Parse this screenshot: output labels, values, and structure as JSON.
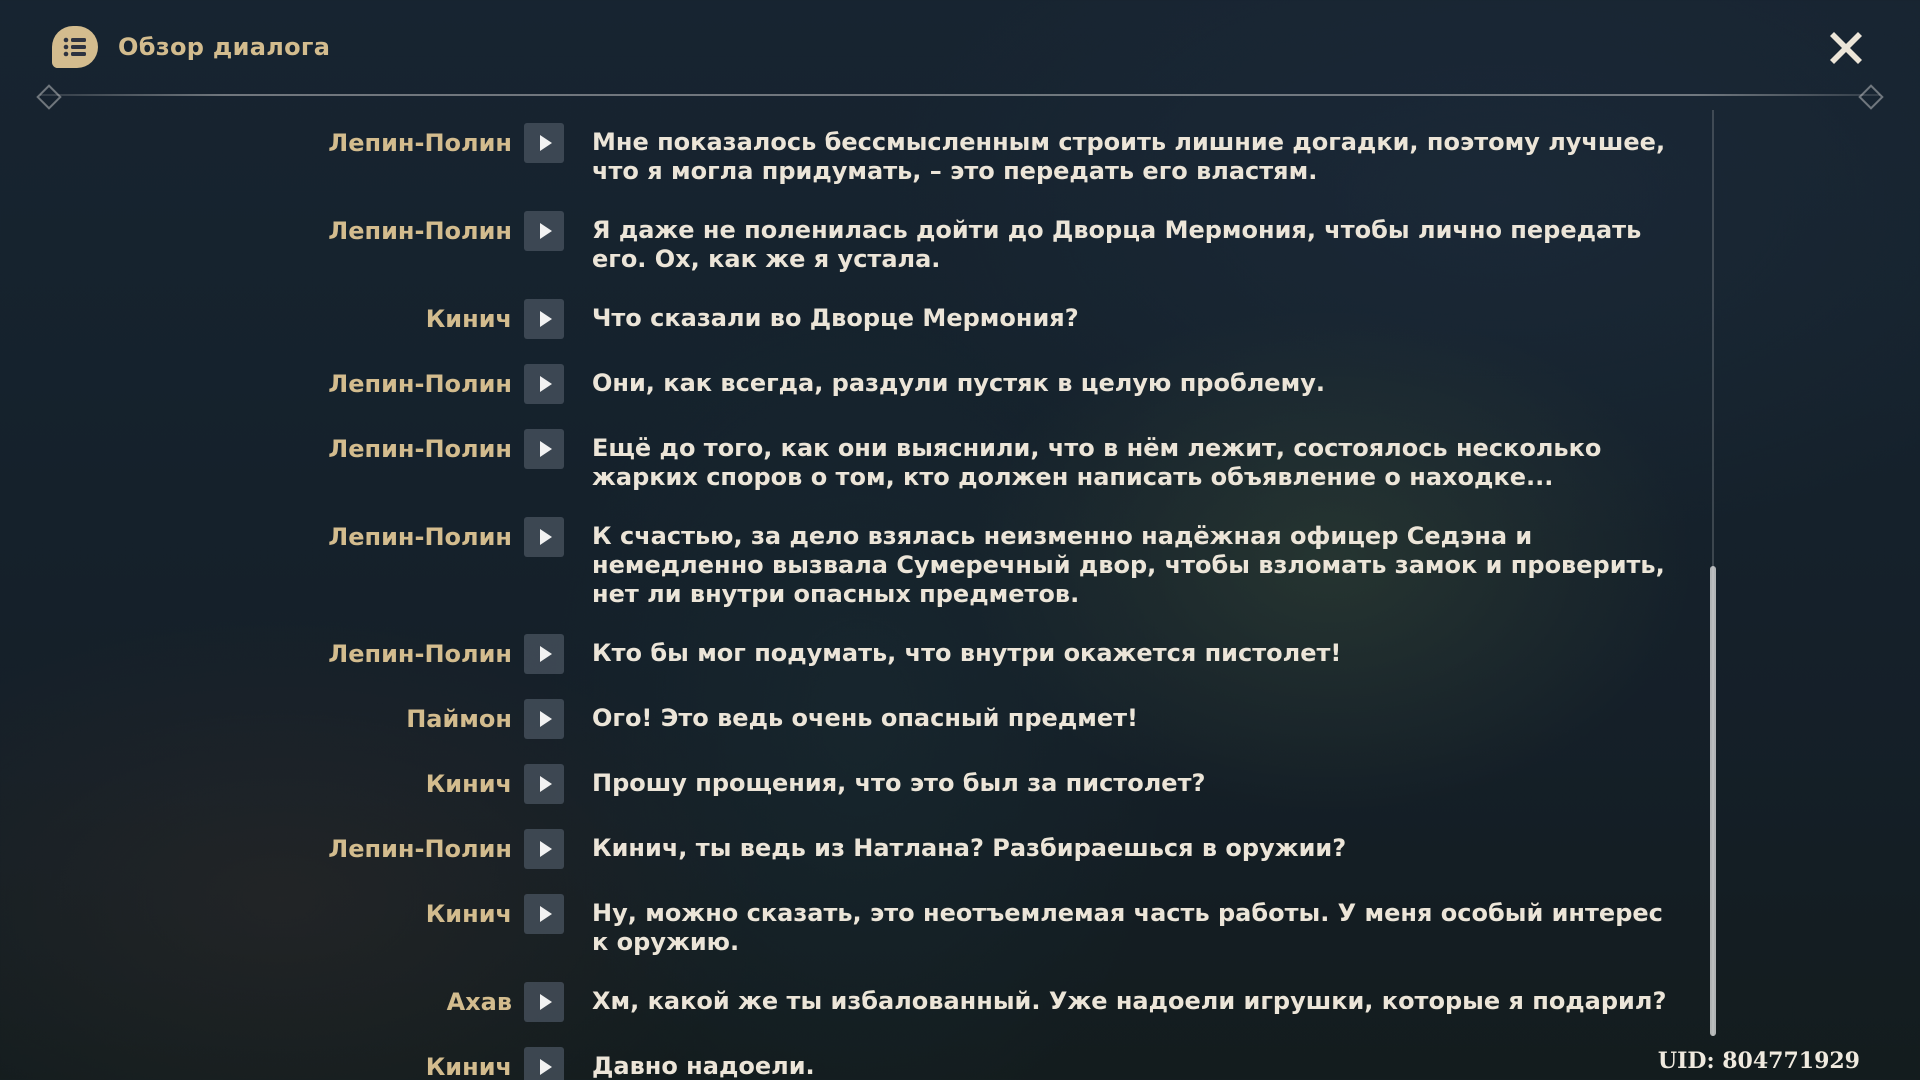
{
  "header": {
    "title": "Обзор диалога",
    "icon": "dialog-history-icon",
    "close_icon": "close-icon"
  },
  "colors": {
    "accent": "#d3bc8e",
    "text": "#ece5d8"
  },
  "dialog": [
    {
      "speaker": "Лепин-Полин",
      "text": "Мне показалось бессмысленным строить лишние догадки, поэтому лучшее, что я могла придумать, – это передать его властям."
    },
    {
      "speaker": "Лепин-Полин",
      "text": "Я даже не поленилась дойти до Дворца Мермония, чтобы лично передать его. Ох, как же я устала."
    },
    {
      "speaker": "Кинич",
      "text": "Что сказали во Дворце Мермония?"
    },
    {
      "speaker": "Лепин-Полин",
      "text": "Они, как всегда, раздули пустяк в целую проблему."
    },
    {
      "speaker": "Лепин-Полин",
      "text": "Ещё до того, как они выяснили, что в нём лежит, состоялось несколько жарких споров о том, кто должен написать объявление о находке..."
    },
    {
      "speaker": "Лепин-Полин",
      "text": "К счастью, за дело взялась неизменно надёжная офицер Седэна и немедленно вызвала Сумеречный двор, чтобы взломать замок и проверить, нет ли внутри опасных предметов."
    },
    {
      "speaker": "Лепин-Полин",
      "text": "Кто бы мог подумать, что внутри окажется пистолет!"
    },
    {
      "speaker": "Паймон",
      "text": "Ого! Это ведь очень опасный предмет!"
    },
    {
      "speaker": "Кинич",
      "text": "Прошу прощения, что это был за пистолет?"
    },
    {
      "speaker": "Лепин-Полин",
      "text": "Кинич, ты ведь из Натлана? Разбираешься в оружии?"
    },
    {
      "speaker": "Кинич",
      "text": "Ну, можно сказать, это неотъемлемая часть работы. У меня особый интерес к оружию."
    },
    {
      "speaker": "Ахав",
      "text": "Хм, какой же ты избалованный. Уже надоели игрушки, которые я подарил?"
    },
    {
      "speaker": "Кинич",
      "text": "Давно надоели."
    }
  ],
  "uid": "UID: 804771929"
}
